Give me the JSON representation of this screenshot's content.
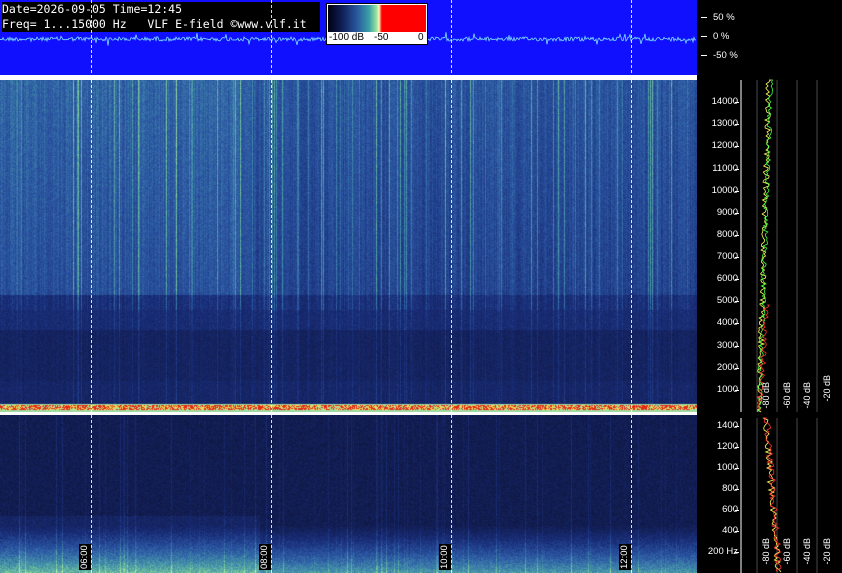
{
  "header": {
    "date_line": "Date=2026-09-05 Time=12:45",
    "freq_line": "Freq= 1...15000 Hz   VLF E-field ©www.vlf.it"
  },
  "scale": {
    "labels": [
      "-100 dB",
      "-50",
      "0"
    ]
  },
  "amplitude_axis": {
    "labels": [
      "50 %",
      "0 %",
      "-50 %"
    ]
  },
  "freq_axis_main": {
    "labels": [
      "14000",
      "13000",
      "12000",
      "11000",
      "10000",
      "9000",
      "8000",
      "7000",
      "6000",
      "5000",
      "4000",
      "3000",
      "2000",
      "1000"
    ]
  },
  "freq_axis_low": {
    "labels": [
      "1400",
      "1200",
      "1000",
      "800",
      "600",
      "400",
      "200 Hz"
    ]
  },
  "db_axis_main": {
    "labels": [
      "-80 dB",
      "-60 dB",
      "-40 dB",
      "-20 dB"
    ]
  },
  "db_axis_low": {
    "labels": [
      "-80 dB",
      "-60 dB",
      "-40 dB",
      "-20 dB"
    ]
  },
  "time_axis": {
    "labels": [
      "06:00",
      "08:00",
      "10:00",
      "12:00"
    ]
  },
  "colors": {
    "background": "#000000",
    "waveform_panel": "#1010ff",
    "spectrum_dark": "#121a4a",
    "spectrum_mid": "#2c4a9c",
    "spectrum_bright": "#7ad0a0",
    "hot_line": "#ff2020"
  }
}
